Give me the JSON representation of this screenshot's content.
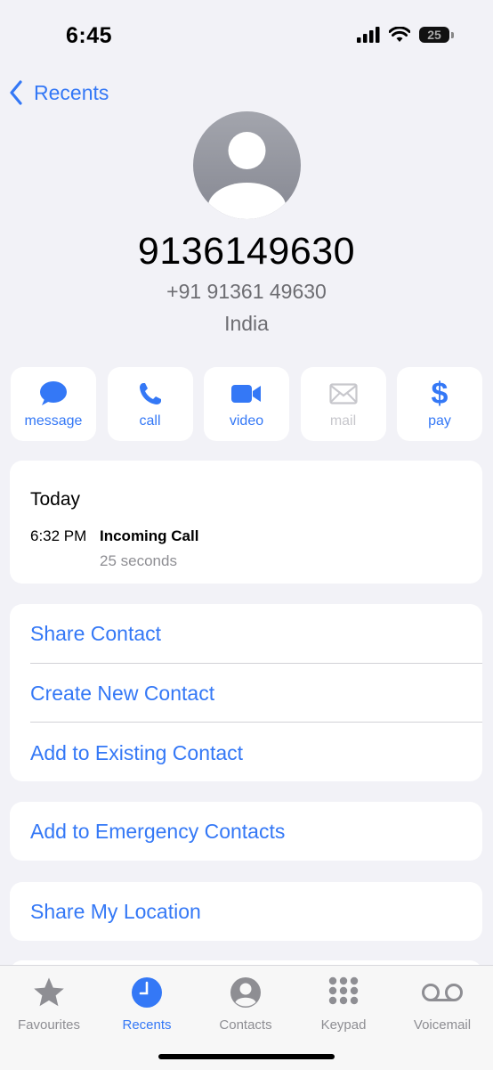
{
  "status_bar": {
    "time": "6:45",
    "battery_level": "25"
  },
  "nav": {
    "back_label": "Recents"
  },
  "contact": {
    "title_number": "9136149630",
    "formatted_number": "+91 91361 49630",
    "country": "India"
  },
  "actions": [
    {
      "label": "message",
      "icon": "message-bubble-icon",
      "enabled": true
    },
    {
      "label": "call",
      "icon": "phone-icon",
      "enabled": true
    },
    {
      "label": "video",
      "icon": "video-camera-icon",
      "enabled": true
    },
    {
      "label": "mail",
      "icon": "envelope-icon",
      "enabled": false
    },
    {
      "label": "pay",
      "icon": "dollar-icon",
      "enabled": true
    }
  ],
  "history": {
    "day": "Today",
    "time": "6:32 PM",
    "type": "Incoming Call",
    "duration": "25 seconds"
  },
  "contact_actions": [
    "Share Contact",
    "Create New Contact",
    "Add to Existing Contact"
  ],
  "emergency": "Add to Emergency Contacts",
  "share_location": "Share My Location",
  "tabs": [
    {
      "label": "Favourites",
      "icon": "star-icon",
      "active": false
    },
    {
      "label": "Recents",
      "icon": "clock-icon",
      "active": true
    },
    {
      "label": "Contacts",
      "icon": "person-circle-icon",
      "active": false
    },
    {
      "label": "Keypad",
      "icon": "keypad-icon",
      "active": false
    },
    {
      "label": "Voicemail",
      "icon": "voicemail-icon",
      "active": false
    }
  ],
  "colors": {
    "accent": "#3478f6",
    "background": "#f2f2f7",
    "secondary_text": "#6d6d72",
    "disabled": "#c7c7cc"
  }
}
